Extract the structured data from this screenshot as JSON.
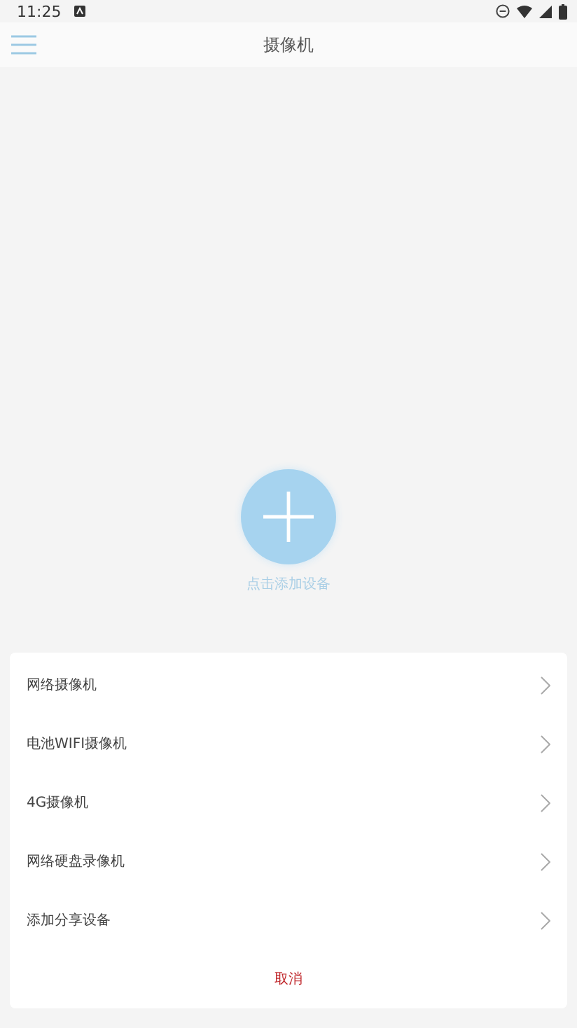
{
  "status_bar": {
    "time": "11:25"
  },
  "header": {
    "title": "摄像机"
  },
  "add_device": {
    "label": "点击添加设备"
  },
  "sheet": {
    "items": [
      {
        "label": "网络摄像机"
      },
      {
        "label": "电池WIFI摄像机"
      },
      {
        "label": "4G摄像机"
      },
      {
        "label": "网络硬盘录像机"
      },
      {
        "label": "添加分享设备"
      }
    ],
    "cancel": "取消"
  }
}
